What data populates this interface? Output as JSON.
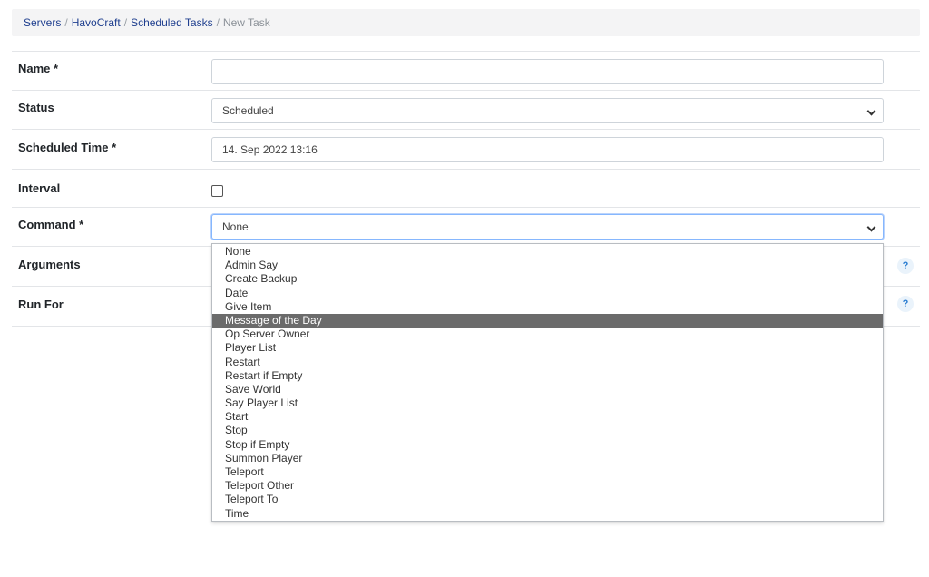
{
  "breadcrumb": {
    "items": [
      "Servers",
      "HavoCraft",
      "Scheduled Tasks"
    ],
    "current": "New Task",
    "separator": "/"
  },
  "form": {
    "name": {
      "label": "Name *",
      "value": ""
    },
    "status": {
      "label": "Status",
      "value": "Scheduled"
    },
    "scheduled_time": {
      "label": "Scheduled Time *",
      "value": "14. Sep 2022 13:16"
    },
    "interval": {
      "label": "Interval",
      "checked": false
    },
    "command": {
      "label": "Command *",
      "value": "None"
    },
    "arguments": {
      "label": "Arguments",
      "help": "?"
    },
    "run_for": {
      "label": "Run For",
      "help": "?"
    }
  },
  "command_options": [
    "None",
    "Admin Say",
    "Create Backup",
    "Date",
    "Give Item",
    "Message of the Day",
    "Op Server Owner",
    "Player List",
    "Restart",
    "Restart if Empty",
    "Save World",
    "Say Player List",
    "Start",
    "Stop",
    "Stop if Empty",
    "Summon Player",
    "Teleport",
    "Teleport Other",
    "Teleport To",
    "Time"
  ],
  "highlighted_option": "Message of the Day",
  "colors": {
    "link": "#1f3f8f",
    "highlight": "#6b6b6b",
    "help_icon": "#2a7dd1"
  }
}
